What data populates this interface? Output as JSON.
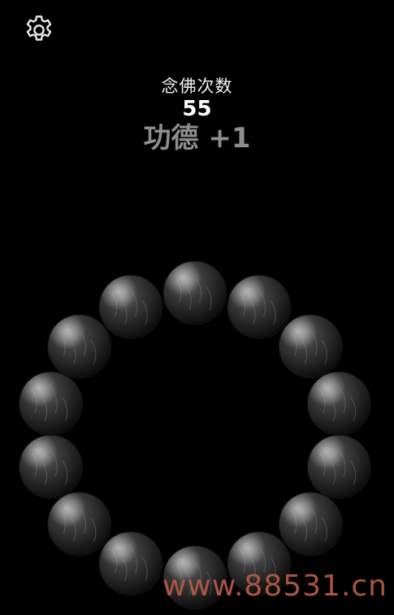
{
  "header": {
    "settings_icon": "gear-icon"
  },
  "counter": {
    "label": "念佛次数",
    "value": "55"
  },
  "merit": {
    "text": "功德 +1"
  },
  "bracelet": {
    "bead_count": 14,
    "bead_color": "#3a3a3a"
  },
  "watermark": {
    "text": "www.88531.cn",
    "color": "#b35a46"
  }
}
